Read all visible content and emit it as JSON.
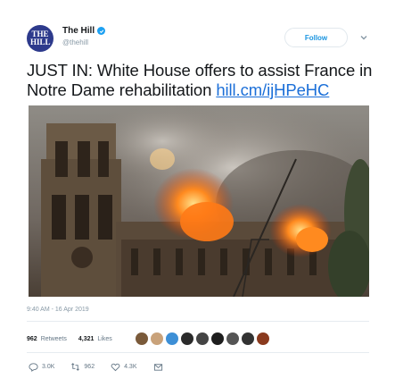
{
  "account": {
    "name": "The Hill",
    "handle": "@thehill",
    "avatar_text": "THE HILL",
    "verified_color": "#1da1f2"
  },
  "follow_button": {
    "label": "Follow"
  },
  "tweet": {
    "text": "JUST IN: White House offers to assist France in Notre Dame rehabilitation ",
    "link": "hill.cm/ijHPeHC"
  },
  "photo": {
    "icon": "notre-dame-fire-photo"
  },
  "timestamp": "9:40 AM - 16 Apr 2019",
  "stats": {
    "retweets_count": "962",
    "retweets_label": "Retweets",
    "likes_count": "4,321",
    "likes_label": "Likes"
  },
  "likers": [
    "#7a5a3a",
    "#c9a27a",
    "#3d8fd6",
    "#2b2b2b",
    "#444444",
    "#1e1e1e",
    "#555555",
    "#333333",
    "#8a3a1e"
  ],
  "actions": {
    "reply_count": "3.0K",
    "retweet_count": "962",
    "like_count": "4.3K"
  },
  "colors": {
    "link": "#1b6fd8",
    "accent": "#1b95e0",
    "muted": "#8899a6"
  }
}
